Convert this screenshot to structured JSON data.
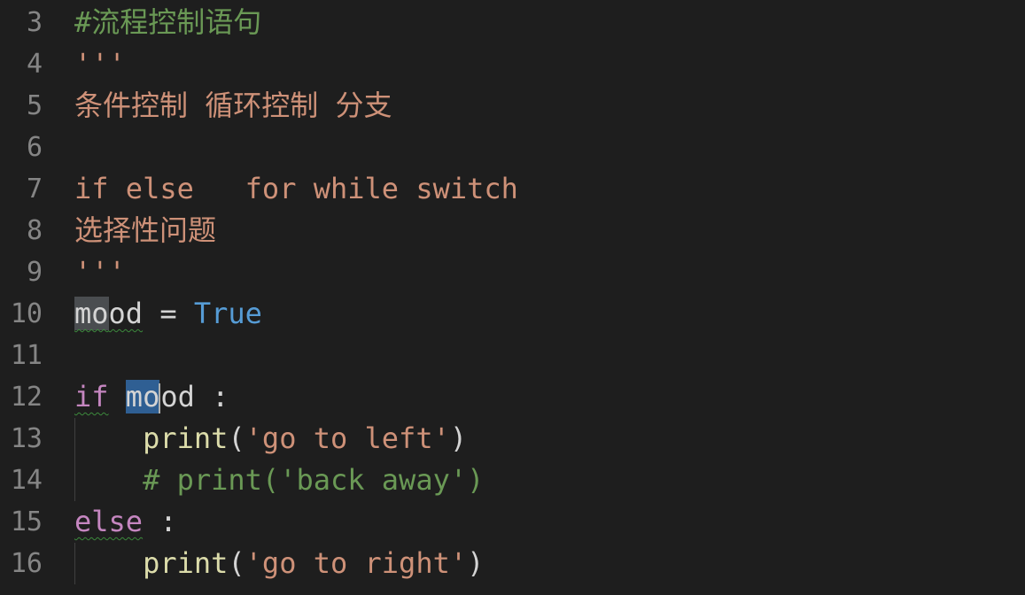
{
  "editor": {
    "colors": {
      "background": "#1e1e1e",
      "line_number": "#858585",
      "comment": "#6a9955",
      "string": "#ce9178",
      "keyword": "#c586c0",
      "constant": "#569cd6",
      "function": "#dcdcaa"
    },
    "lines": [
      {
        "number": "3",
        "tokens": [
          {
            "text": "#流程控制语句",
            "type": "comment"
          }
        ]
      },
      {
        "number": "4",
        "tokens": [
          {
            "text": "'''",
            "type": "string"
          }
        ]
      },
      {
        "number": "5",
        "tokens": [
          {
            "text": "条件控制 循环控制 分支",
            "type": "string"
          }
        ]
      },
      {
        "number": "6",
        "tokens": []
      },
      {
        "number": "7",
        "tokens": [
          {
            "text": "if else   for while switch",
            "type": "string"
          }
        ]
      },
      {
        "number": "8",
        "tokens": [
          {
            "text": "选择性问题",
            "type": "string"
          }
        ]
      },
      {
        "number": "9",
        "tokens": [
          {
            "text": "'''",
            "type": "string"
          }
        ]
      },
      {
        "number": "10",
        "tokens": [
          {
            "text": "mo",
            "type": "var",
            "highlight": "gray",
            "squiggle": true
          },
          {
            "text": "od",
            "type": "var",
            "squiggle": true
          },
          {
            "text": " = ",
            "type": "punc"
          },
          {
            "text": "True",
            "type": "const"
          }
        ]
      },
      {
        "number": "11",
        "tokens": []
      },
      {
        "number": "12",
        "tokens": [
          {
            "text": "if",
            "type": "keyword",
            "squiggle": true
          },
          {
            "text": " ",
            "type": "punc"
          },
          {
            "text": "mo",
            "type": "var",
            "highlight": "blue"
          },
          {
            "text": "",
            "type": "cursor"
          },
          {
            "text": "od",
            "type": "var"
          },
          {
            "text": "I",
            "type": "ibeam"
          },
          {
            "text": " :",
            "type": "punc"
          }
        ]
      },
      {
        "number": "13",
        "guide": true,
        "tokens": [
          {
            "text": "    ",
            "type": "punc"
          },
          {
            "text": "print",
            "type": "func"
          },
          {
            "text": "(",
            "type": "punc"
          },
          {
            "text": "'go to left'",
            "type": "string"
          },
          {
            "text": ")",
            "type": "punc"
          }
        ]
      },
      {
        "number": "14",
        "guide": true,
        "tokens": [
          {
            "text": "    ",
            "type": "punc"
          },
          {
            "text": "# print('back away')",
            "type": "comment"
          }
        ]
      },
      {
        "number": "15",
        "tokens": [
          {
            "text": "else",
            "type": "keyword",
            "squiggle": true
          },
          {
            "text": " :",
            "type": "punc"
          }
        ]
      },
      {
        "number": "16",
        "guide": true,
        "tokens": [
          {
            "text": "    ",
            "type": "punc"
          },
          {
            "text": "print",
            "type": "func"
          },
          {
            "text": "(",
            "type": "punc"
          },
          {
            "text": "'go to right'",
            "type": "string"
          },
          {
            "text": ")",
            "type": "punc"
          }
        ]
      }
    ]
  }
}
